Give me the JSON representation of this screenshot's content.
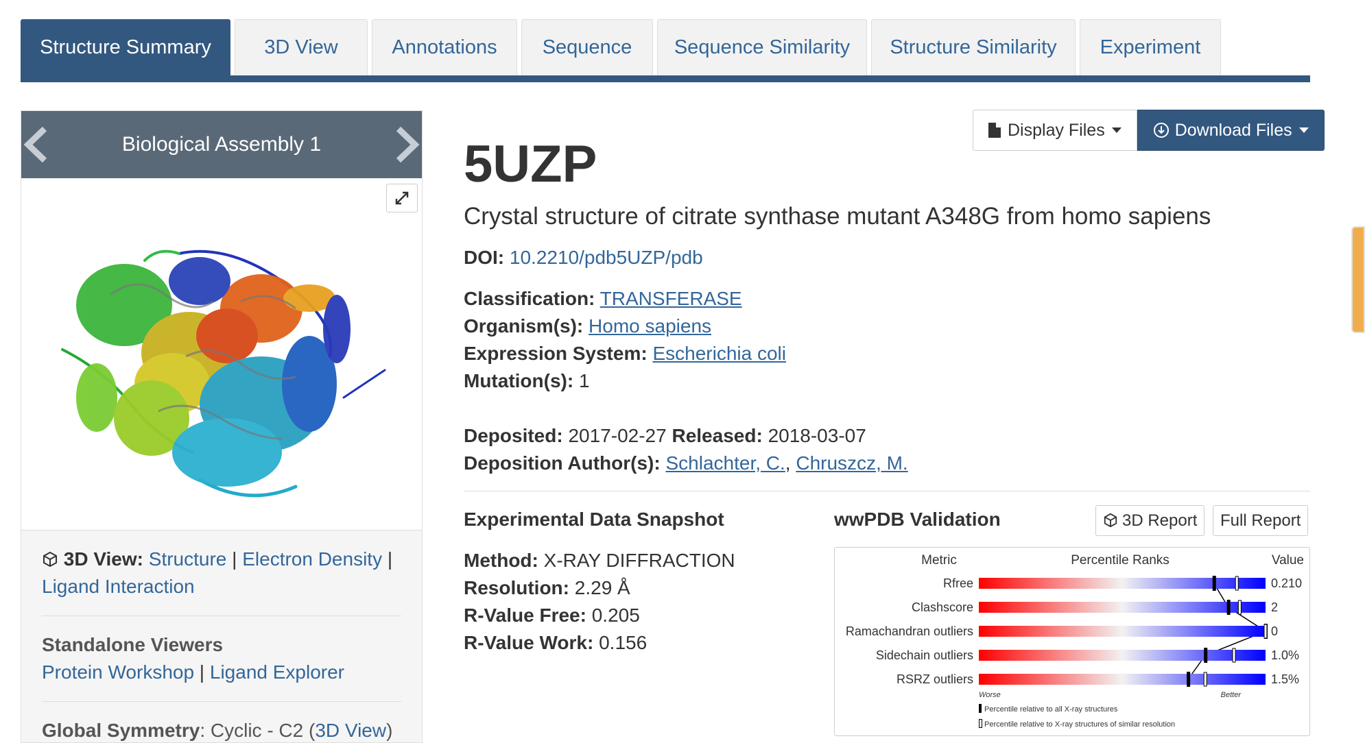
{
  "tabs": [
    {
      "label": "Structure Summary",
      "active": true
    },
    {
      "label": "3D View"
    },
    {
      "label": "Annotations"
    },
    {
      "label": "Sequence"
    },
    {
      "label": "Sequence Similarity"
    },
    {
      "label": "Structure Similarity"
    },
    {
      "label": "Experiment"
    }
  ],
  "assembly": {
    "title": "Biological Assembly 1"
  },
  "left": {
    "view3d_label": "3D View",
    "view3d_colon": ":",
    "link_structure": "Structure",
    "link_density": "Electron Density",
    "link_ligand": "Ligand Interaction",
    "standalone_title": "Standalone Viewers",
    "link_workshop": "Protein Workshop",
    "link_explorer": "Ligand Explorer",
    "symmetry_label": "Global Symmetry",
    "symmetry_value": ": Cyclic - C2",
    "symmetry_link": "3D View"
  },
  "buttons": {
    "display_files": "Display Files",
    "download_files": "Download Files"
  },
  "entry": {
    "id": "5UZP",
    "title": "Crystal structure of citrate synthase mutant A348G from homo sapiens",
    "doi_label": "DOI:",
    "doi": "10.2210/pdb5UZP/pdb",
    "classification_label": "Classification:",
    "classification": "TRANSFERASE",
    "organism_label": "Organism(s):",
    "organism": "Homo sapiens",
    "expression_label": "Expression System:",
    "expression": "Escherichia coli",
    "mutation_label": "Mutation(s):",
    "mutation": "1",
    "deposited_label": "Deposited:",
    "deposited": "2017-02-27",
    "released_label": "Released:",
    "released": "2018-03-07",
    "authors_label": "Deposition Author(s):",
    "author1": "Schlachter, C.",
    "author2": "Chruszcz, M."
  },
  "snapshot": {
    "title": "Experimental Data Snapshot",
    "method_label": "Method:",
    "method": "X-RAY DIFFRACTION",
    "resolution_label": "Resolution:",
    "resolution": "2.29 Å",
    "rfree_label": "R-Value Free:",
    "rfree": "0.205",
    "rwork_label": "R-Value Work:",
    "rwork": "0.156"
  },
  "validation": {
    "title": "wwPDB Validation",
    "report3d": "3D Report",
    "full_report": "Full Report",
    "col_metric": "Metric",
    "col_percentile": "Percentile Ranks",
    "col_value": "Value",
    "worse": "Worse",
    "better": "Better",
    "legend_all": "Percentile relative to all X-ray structures",
    "legend_similar": "Percentile relative to X-ray structures of similar resolution",
    "metrics": [
      {
        "name": "Rfree",
        "value": "0.210",
        "pct_all": 0.82,
        "pct_similar": 0.9
      },
      {
        "name": "Clashscore",
        "value": "2",
        "pct_all": 0.87,
        "pct_similar": 0.91
      },
      {
        "name": "Ramachandran outliers",
        "value": "0",
        "pct_all": 1.0,
        "pct_similar": 1.0
      },
      {
        "name": "Sidechain outliers",
        "value": "1.0%",
        "pct_all": 0.79,
        "pct_similar": 0.89
      },
      {
        "name": "RSRZ outliers",
        "value": "1.5%",
        "pct_all": 0.73,
        "pct_similar": 0.79
      }
    ]
  }
}
